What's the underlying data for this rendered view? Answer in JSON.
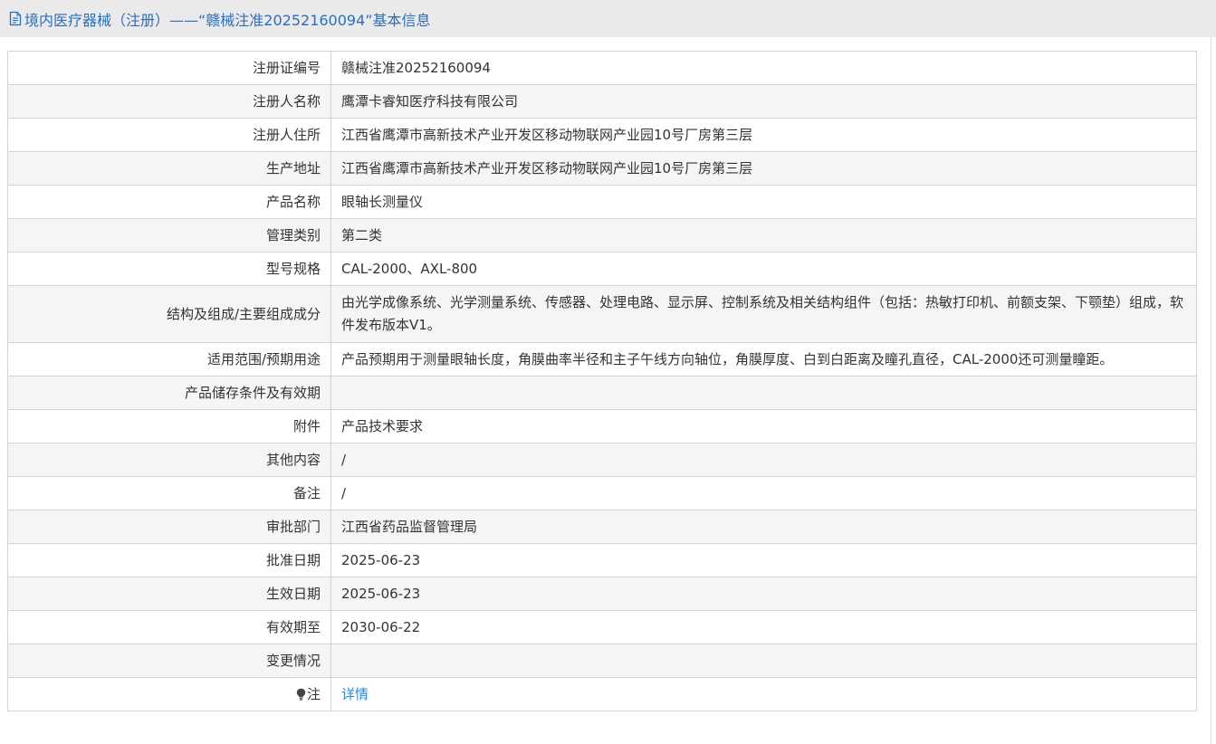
{
  "header": {
    "title": "境内医疗器械（注册）——“赣械注准20252160094”基本信息",
    "icon": "document-icon"
  },
  "rows": [
    {
      "label": "注册证编号",
      "value": "赣械注准20252160094"
    },
    {
      "label": "注册人名称",
      "value": "鹰潭卡睿知医疗科技有限公司"
    },
    {
      "label": "注册人住所",
      "value": "江西省鹰潭市高新技术产业开发区移动物联网产业园10号厂房第三层"
    },
    {
      "label": "生产地址",
      "value": "江西省鹰潭市高新技术产业开发区移动物联网产业园10号厂房第三层"
    },
    {
      "label": "产品名称",
      "value": "眼轴长测量仪"
    },
    {
      "label": "管理类别",
      "value": "第二类"
    },
    {
      "label": "型号规格",
      "value": "CAL-2000、AXL-800"
    },
    {
      "label": "结构及组成/主要组成成分",
      "value": "由光学成像系统、光学测量系统、传感器、处理电路、显示屏、控制系统及相关结构组件（包括：热敏打印机、前额支架、下颚垫）组成，软件发布版本V1。"
    },
    {
      "label": "适用范围/预期用途",
      "value": "产品预期用于测量眼轴长度，角膜曲率半径和主子午线方向轴位，角膜厚度、白到白距离及瞳孔直径，CAL-2000还可测量瞳距。"
    },
    {
      "label": "产品储存条件及有效期",
      "value": ""
    },
    {
      "label": "附件",
      "value": "产品技术要求"
    },
    {
      "label": "其他内容",
      "value": "/"
    },
    {
      "label": "备注",
      "value": "/"
    },
    {
      "label": "审批部门",
      "value": "江西省药品监督管理局"
    },
    {
      "label": "批准日期",
      "value": "2025-06-23"
    },
    {
      "label": "生效日期",
      "value": "2025-06-23"
    },
    {
      "label": "有效期至",
      "value": "2030-06-22"
    },
    {
      "label": "变更情况",
      "value": ""
    }
  ],
  "note": {
    "label": "注",
    "icon": "lightbulb-icon",
    "link_text": "详情"
  },
  "colors": {
    "title": "#2a6fbe",
    "link": "#2a8bd8",
    "header_bg": "#eaeaea",
    "stripe": "#f5f5f5",
    "border": "#d4d4d4"
  }
}
